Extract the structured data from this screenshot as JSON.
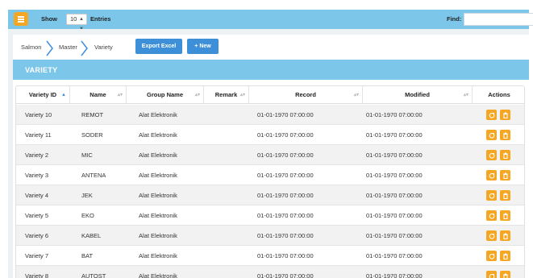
{
  "toolbar": {
    "show_label": "Show",
    "show_value": "10",
    "entries_label": "Entries",
    "find_label": "Find:",
    "find_value": ""
  },
  "breadcrumb": [
    "Salmon",
    "Master",
    "Variety"
  ],
  "buttons": {
    "export": "Export Excel",
    "new": "+ New"
  },
  "panel": {
    "title": "VARIETY"
  },
  "table": {
    "headers": [
      "Variety ID",
      "Name",
      "Group Name",
      "Remark",
      "Record",
      "Modified",
      "Actions"
    ],
    "rows": [
      [
        "Variety 10",
        "REMOT",
        "Alat Elektronik",
        "",
        "01-01-1970 07:00:00",
        "01-01-1970 07:00:00"
      ],
      [
        "Variety 11",
        "SODER",
        "Alat Elektronik",
        "",
        "01-01-1970 07:00:00",
        "01-01-1970 07:00:00"
      ],
      [
        "Variety 2",
        "MIC",
        "Alat Elektronik",
        "",
        "01-01-1970 07:00:00",
        "01-01-1970 07:00:00"
      ],
      [
        "Variety 3",
        "ANTENA",
        "Alat Elektronik",
        "",
        "01-01-1970 07:00:00",
        "01-01-1970 07:00:00"
      ],
      [
        "Variety 4",
        "JEK",
        "Alat Elektronik",
        "",
        "01-01-1970 07:00:00",
        "01-01-1970 07:00:00"
      ],
      [
        "Variety 5",
        "EKO",
        "Alat Elektronik",
        "",
        "01-01-1970 07:00:00",
        "01-01-1970 07:00:00"
      ],
      [
        "Variety 6",
        "KABEL",
        "Alat Elektronik",
        "",
        "01-01-1970 07:00:00",
        "01-01-1970 07:00:00"
      ],
      [
        "Variety 7",
        "BAT",
        "Alat Elektronik",
        "",
        "01-01-1970 07:00:00",
        "01-01-1970 07:00:00"
      ],
      [
        "Variety 8",
        "AUTOST",
        "Alat Elektronik",
        "",
        "01-01-1970 07:00:00",
        "01-01-1970 07:00:00"
      ]
    ]
  },
  "icons": {
    "menu": "hamburger-icon",
    "edit": "edit-icon",
    "delete": "trash-icon",
    "sort": "sort-icon"
  },
  "colors": {
    "header_bar": "#7cc6ea",
    "accent_orange": "#f5a623",
    "button_blue": "#3d8fd8"
  }
}
